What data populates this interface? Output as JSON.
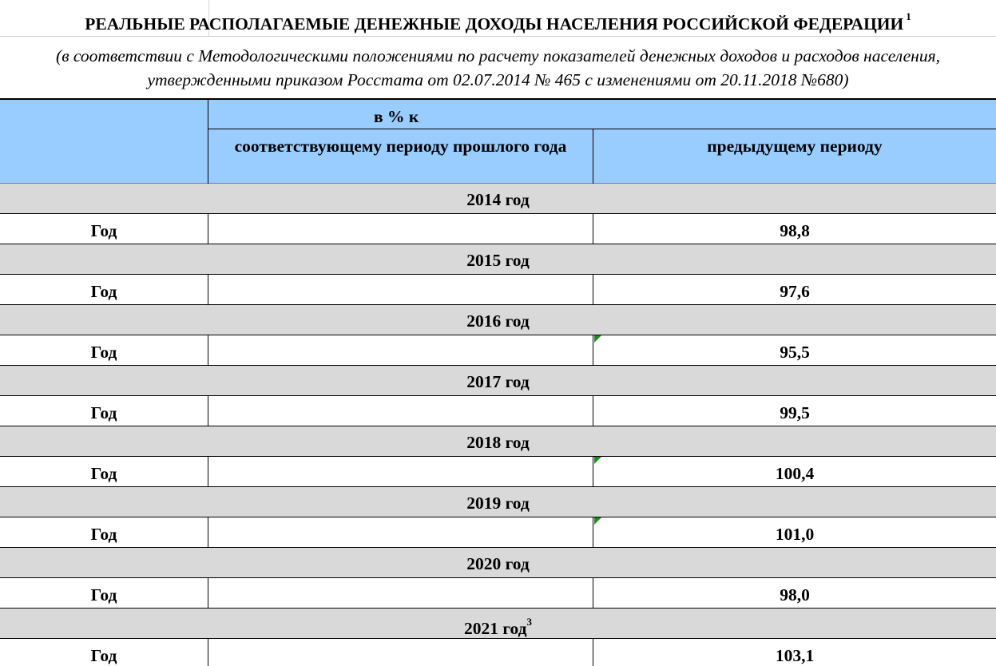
{
  "title": "РЕАЛЬНЫЕ РАСПОЛАГАЕМЫЕ ДЕНЕЖНЫЕ ДОХОДЫ НАСЕЛЕНИЯ РОССИЙСКОЙ ФЕДЕРАЦИИ",
  "title_footnote": "1",
  "subtitle": "(в соответствии с Методологическими положениями по расчету показателей денежных доходов и расходов населения, утвержденными приказом Росстата от 02.07.2014 № 465 с изменениями от 20.11.2018 №680)",
  "header": {
    "group_label": "в % к",
    "col_same_period": "соответствующему периоду прошлого года",
    "col_previous_period": "предыдущему периоду"
  },
  "colors": {
    "header_bg": "#99ccff",
    "year_row_bg": "#d9d9d9",
    "comment_marker": "#1e8c1e"
  },
  "years": [
    {
      "label": "2014 год",
      "footnote": "",
      "row_label": "Год",
      "same_period": "",
      "previous_period": "98,8",
      "has_comment": false
    },
    {
      "label": "2015 год",
      "footnote": "",
      "row_label": "Год",
      "same_period": "",
      "previous_period": "97,6",
      "has_comment": false
    },
    {
      "label": "2016 год",
      "footnote": "",
      "row_label": "Год",
      "same_period": "",
      "previous_period": "95,5",
      "has_comment": true
    },
    {
      "label": "2017 год",
      "footnote": "",
      "row_label": "Год",
      "same_period": "",
      "previous_period": "99,5",
      "has_comment": false
    },
    {
      "label": "2018 год",
      "footnote": "",
      "row_label": "Год",
      "same_period": "",
      "previous_period": "100,4",
      "has_comment": true
    },
    {
      "label": "2019 год",
      "footnote": "",
      "row_label": "Год",
      "same_period": "",
      "previous_period": "101,0",
      "has_comment": true
    },
    {
      "label": "2020 год",
      "footnote": "",
      "row_label": "Год",
      "same_period": "",
      "previous_period": "98,0",
      "has_comment": false
    },
    {
      "label": "2021 год",
      "footnote": "3",
      "row_label": "Год",
      "same_period": "",
      "previous_period": "103,1",
      "has_comment": false
    }
  ]
}
